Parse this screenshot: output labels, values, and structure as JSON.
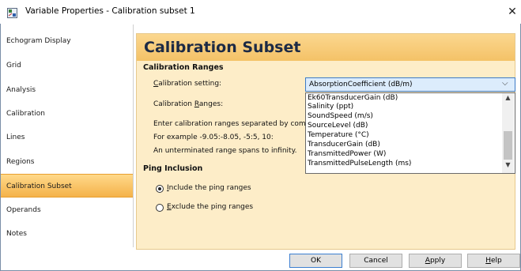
{
  "window": {
    "title": "Variable Properties - Calibration subset 1",
    "close_glyph": "✕"
  },
  "sidebar": {
    "items": [
      {
        "label": "Echogram Display",
        "selected": false
      },
      {
        "label": "Grid",
        "selected": false
      },
      {
        "label": "Analysis",
        "selected": false
      },
      {
        "label": "Calibration",
        "selected": false
      },
      {
        "label": "Lines",
        "selected": false
      },
      {
        "label": "Regions",
        "selected": false
      },
      {
        "label": "Calibration Subset",
        "selected": true
      },
      {
        "label": "Operands",
        "selected": false
      },
      {
        "label": "Notes",
        "selected": false
      }
    ]
  },
  "page": {
    "title": "Calibration Subset",
    "calibration_ranges_section": "Calibration Ranges",
    "calibration_setting_label_pre": "",
    "calibration_setting_label_u": "C",
    "calibration_setting_label_post": "alibration setting:",
    "calibration_ranges_label_pre": "Calibration ",
    "calibration_ranges_label_u": "R",
    "calibration_ranges_label_post": "anges:",
    "help_line1": "Enter calibration ranges separated by comr",
    "help_line2": "For example -9.05:-8.05, -5:5, 10:",
    "help_line3": "An unterminated range spans to infinity.",
    "ping_inclusion_section": "Ping Inclusion",
    "include_label_u": "I",
    "include_label_post": "nclude the ping ranges",
    "exclude_label_u": "E",
    "exclude_label_post": "xclude the ping ranges",
    "include_selected": true
  },
  "dropdown": {
    "selected": "AbsorptionCoefficient (dB/m)",
    "options": [
      "Ek60TransducerGain (dB)",
      "Salinity (ppt)",
      "SoundSpeed (m/s)",
      "SourceLevel (dB)",
      "Temperature (°C)",
      "TransducerGain (dB)",
      "TransmittedPower (W)",
      "TransmittedPulseLength (ms)"
    ]
  },
  "buttons": {
    "ok": "OK",
    "cancel": "Cancel",
    "apply_u": "A",
    "apply_post": "pply",
    "help_u": "H",
    "help_post": "elp"
  },
  "colors": {
    "selected_item": "#f4b24a",
    "panel_background": "#fdedc8",
    "dropdown_highlight": "#dcecfc"
  }
}
